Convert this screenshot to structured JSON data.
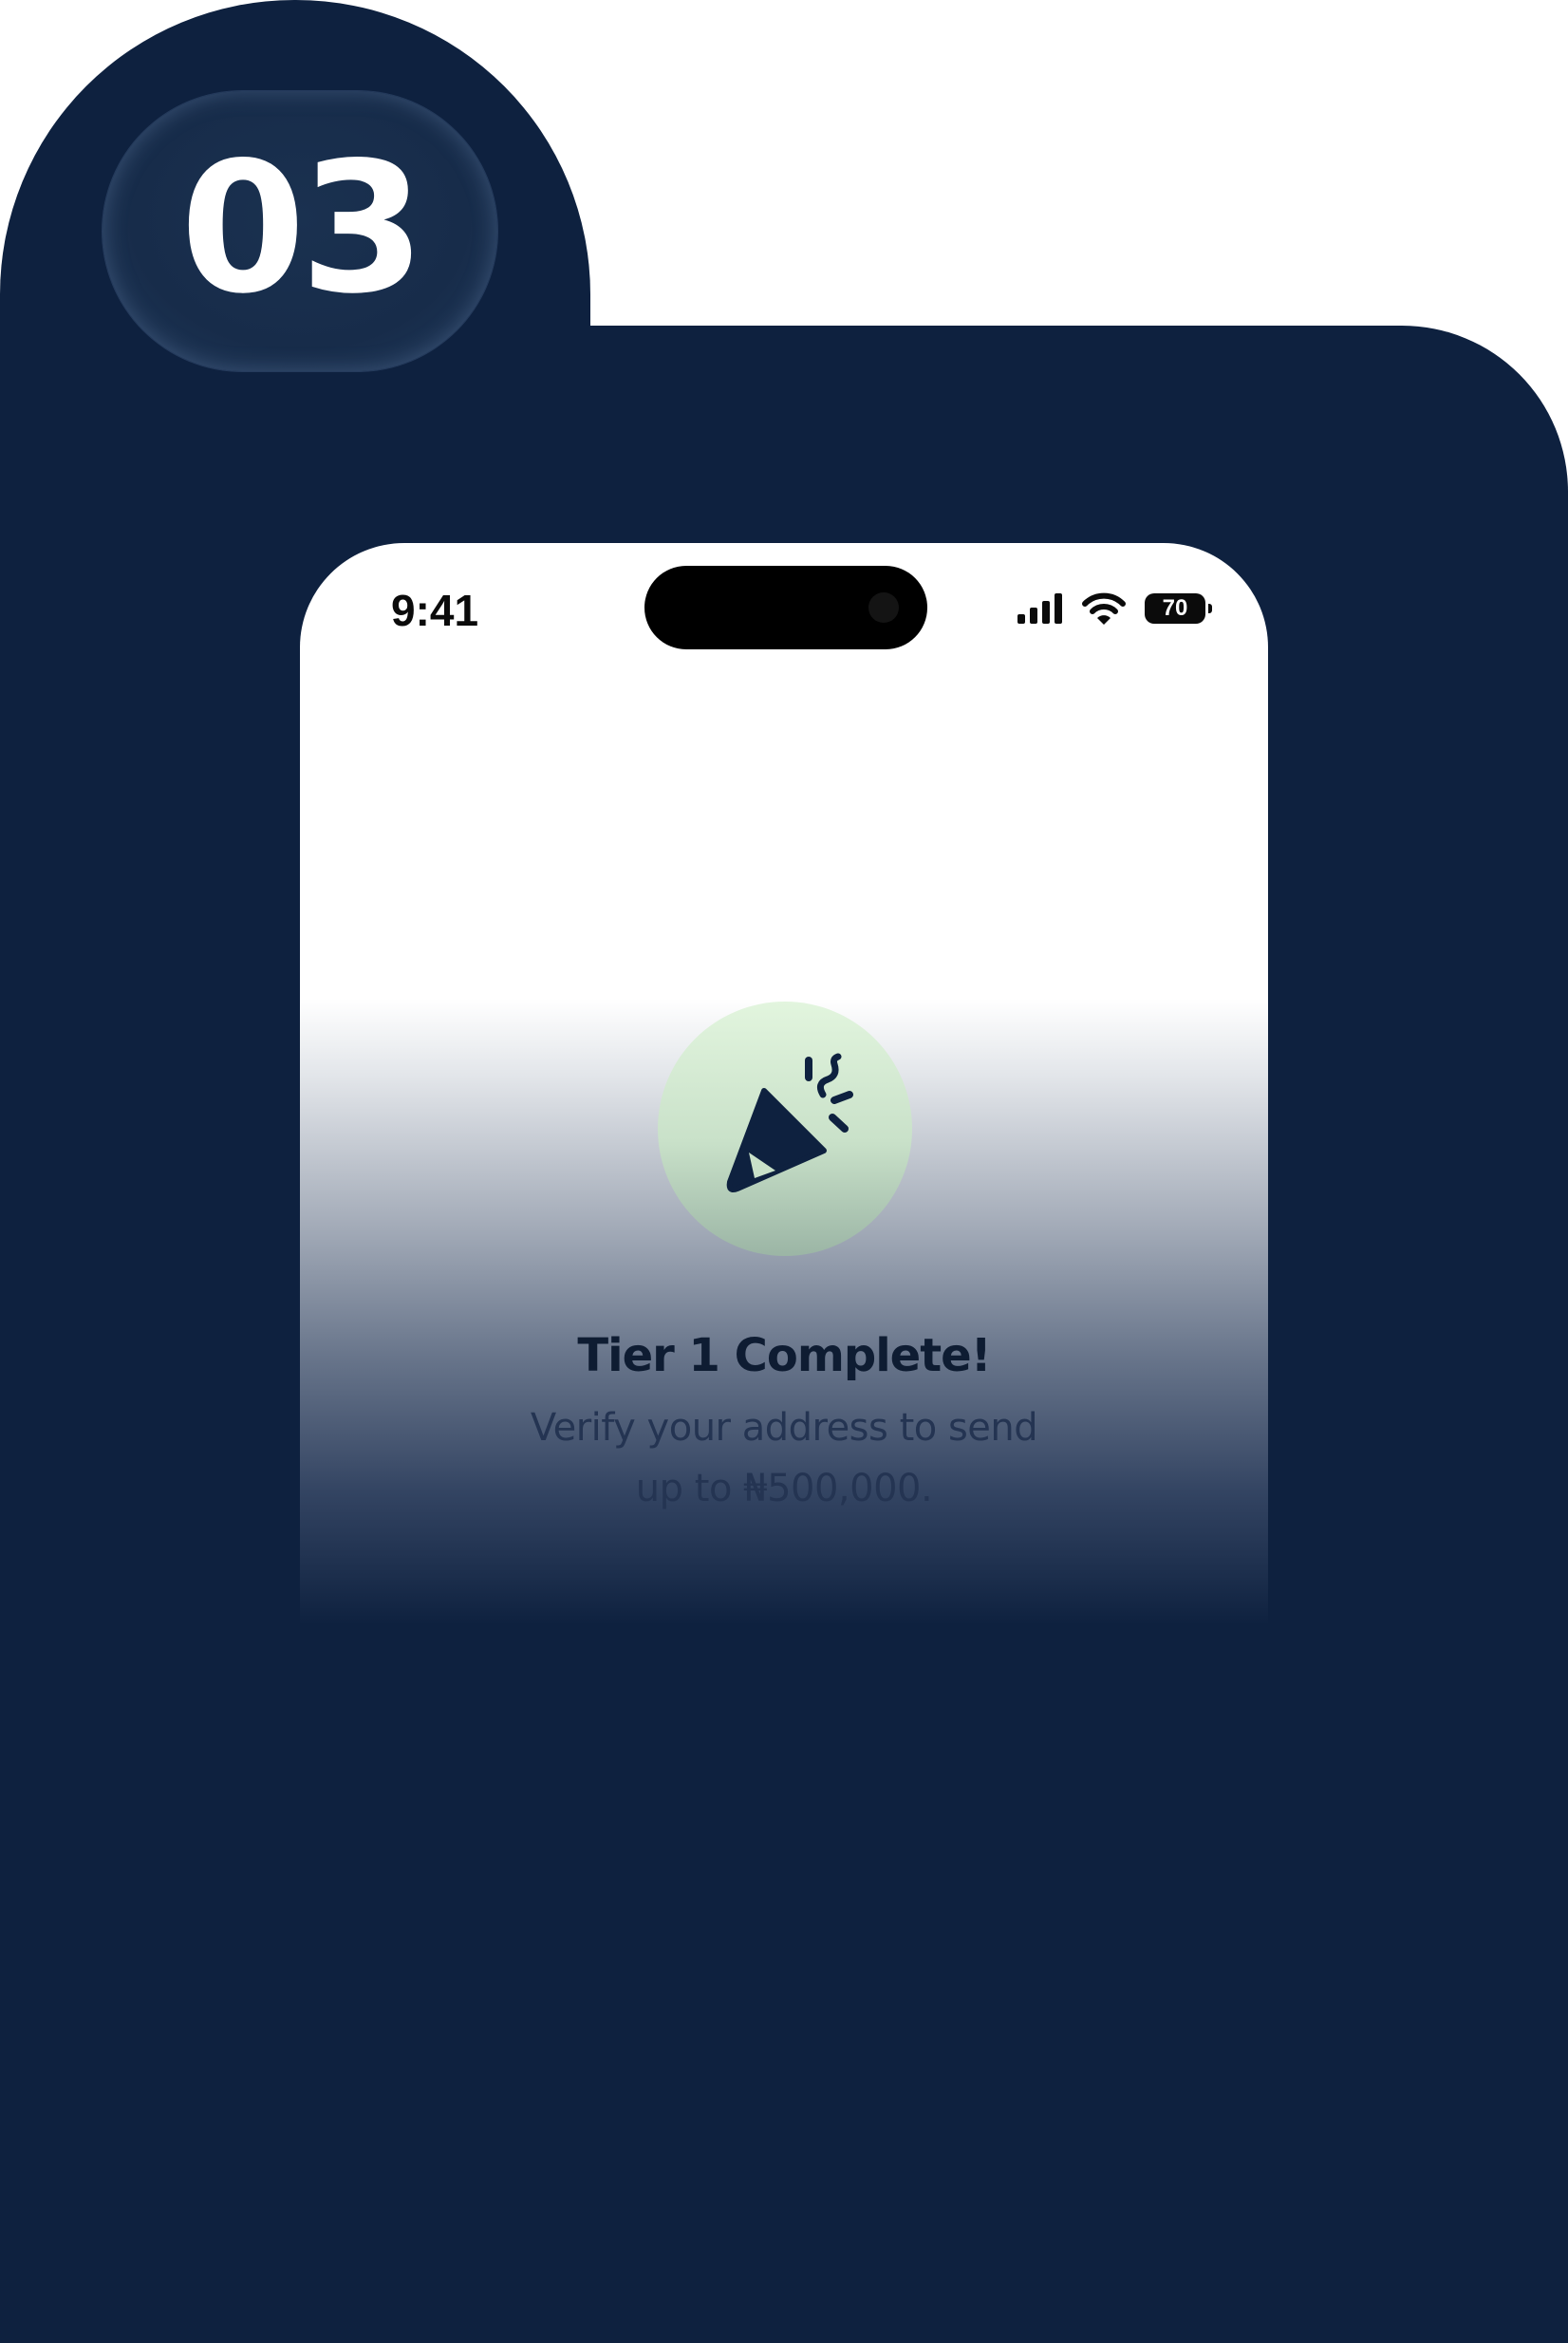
{
  "step": {
    "number": "03"
  },
  "status_bar": {
    "time": "9:41",
    "battery_level": "70",
    "icons": [
      "signal-icon",
      "wifi-icon",
      "battery-icon"
    ]
  },
  "content": {
    "icon": "party-popper-icon",
    "title": "Tier 1 Complete!",
    "subtitle_line1": "Verify your address to send",
    "subtitle_line2": "up to ₦500,000."
  },
  "colors": {
    "background_dark": "#0e213f",
    "icon_circle": "#d5ebd3",
    "icon": "#0e213f"
  }
}
